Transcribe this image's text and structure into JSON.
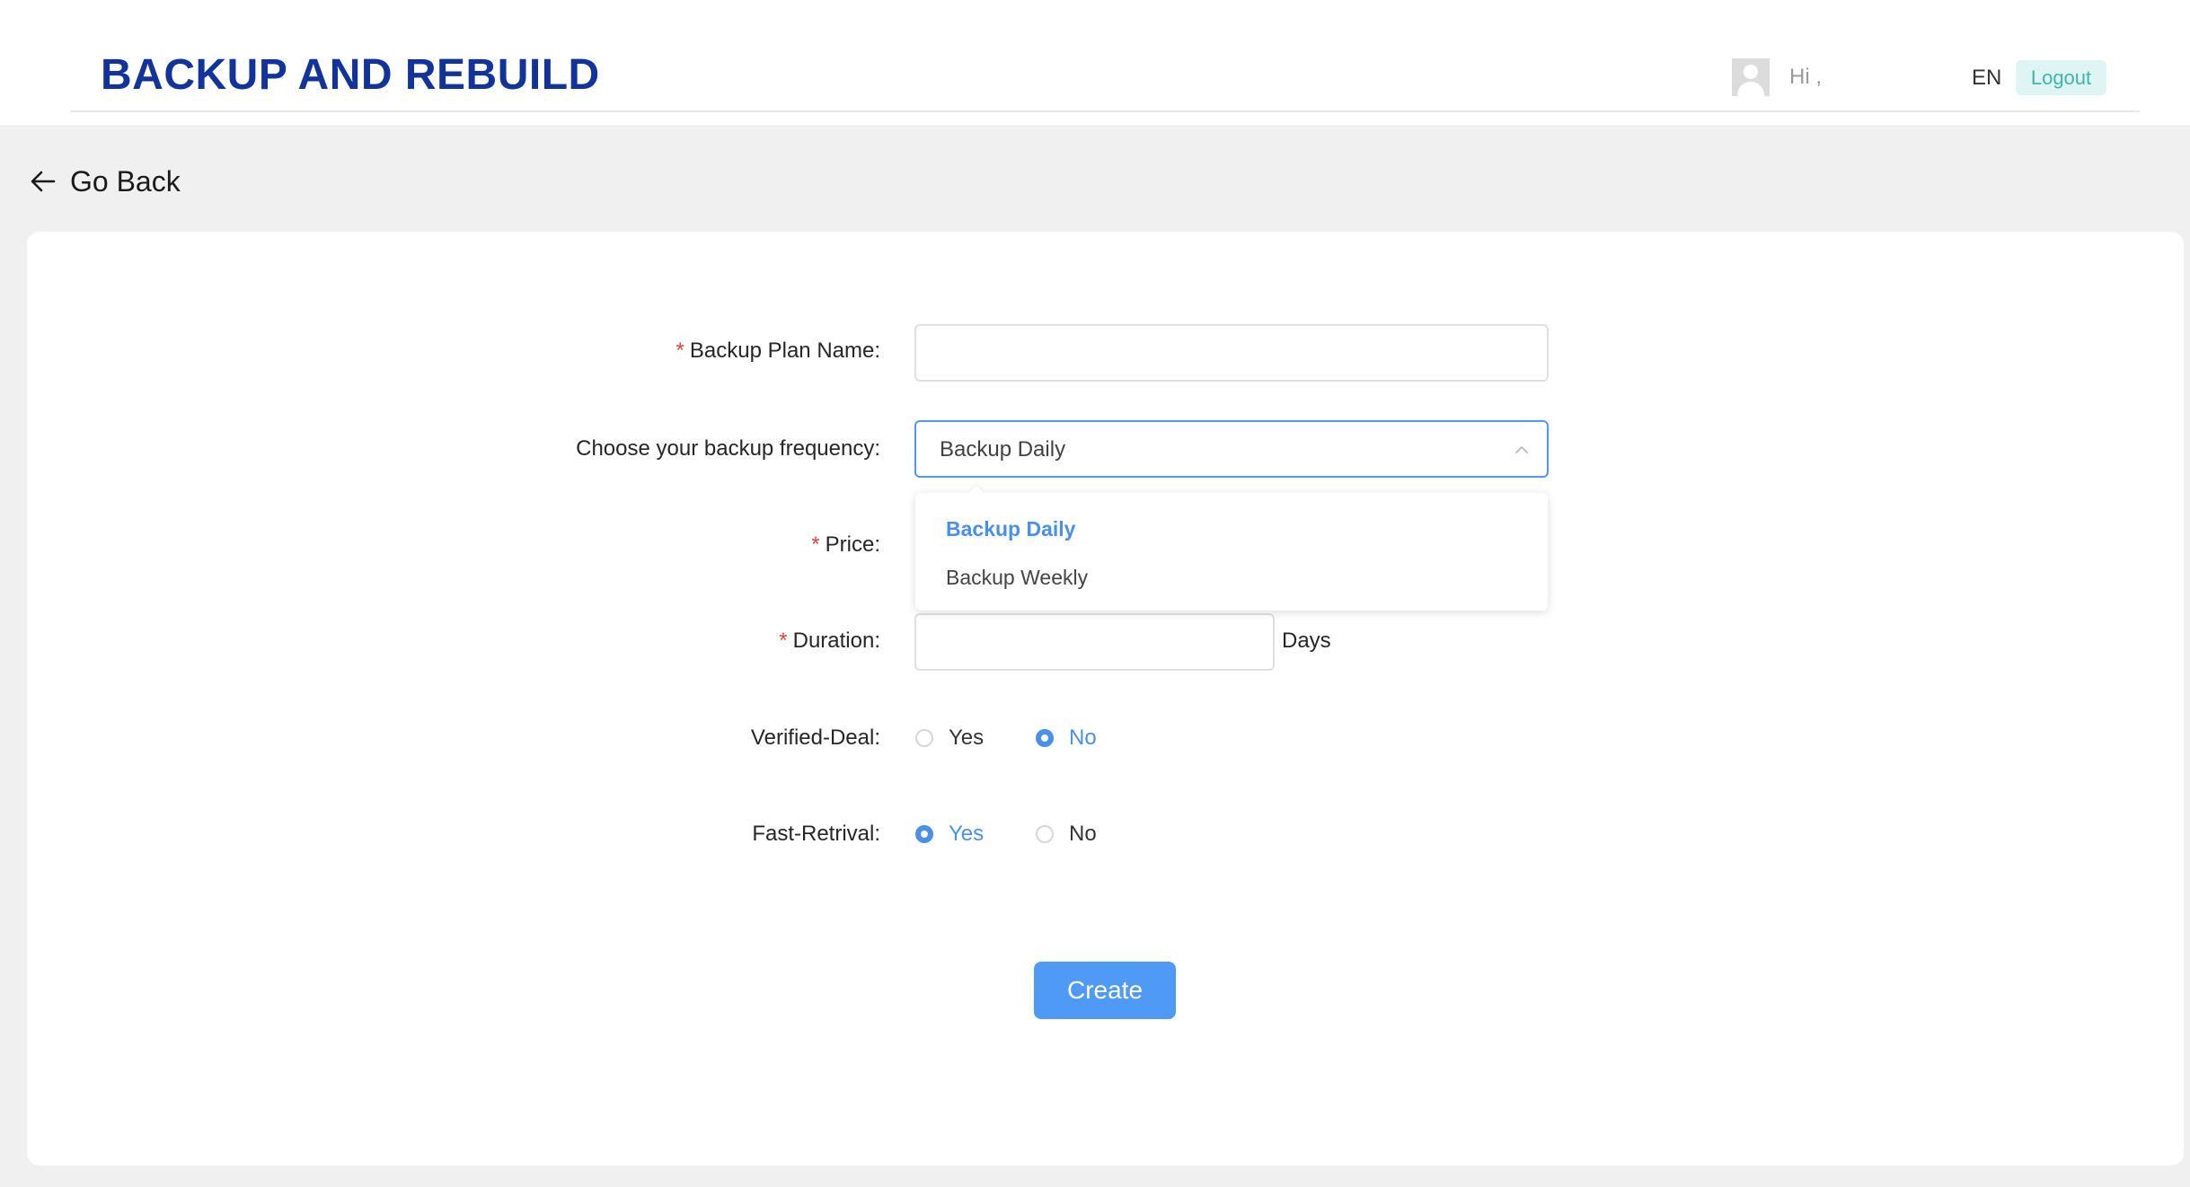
{
  "header": {
    "title": "BACKUP AND REBUILD",
    "greeting": "Hi ,",
    "language": "EN",
    "logout_label": "Logout"
  },
  "nav": {
    "go_back_label": "Go Back"
  },
  "form": {
    "plan_name": {
      "required_mark": "*",
      "label": "Backup Plan Name:",
      "value": ""
    },
    "frequency": {
      "label": "Choose your backup frequency:",
      "selected": "Backup Daily",
      "options": [
        "Backup Daily",
        "Backup Weekly"
      ]
    },
    "price": {
      "required_mark": "*",
      "label": "Price:"
    },
    "duration": {
      "required_mark": "*",
      "label": "Duration:",
      "value": "",
      "unit": "Days"
    },
    "verified_deal": {
      "label": "Verified-Deal:",
      "options": [
        "Yes",
        "No"
      ],
      "selected": "No"
    },
    "fast_retrival": {
      "label": "Fast-Retrival:",
      "options": [
        "Yes",
        "No"
      ],
      "selected": "Yes"
    },
    "create_label": "Create"
  },
  "colors": {
    "brand": "#12349a",
    "accent": "#4e9af5",
    "required": "#e4423b",
    "logout_bg": "#dff5f3",
    "logout_text": "#3fb5aa"
  }
}
